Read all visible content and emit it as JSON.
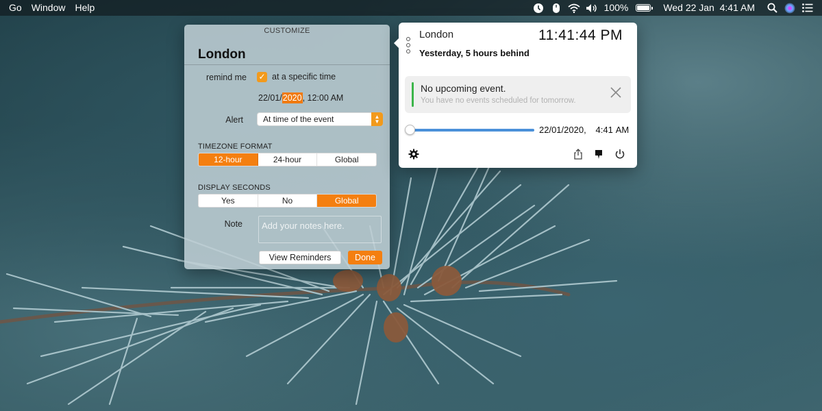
{
  "menubar": {
    "menus": [
      "Go",
      "Window",
      "Help"
    ],
    "battery": "100%",
    "datetime": "Wed 22 Jan  4:41 AM",
    "status_icons": [
      "clock-icon",
      "mouse-icon",
      "wifi-icon",
      "volume-icon",
      "battery-icon",
      "search-icon",
      "siri-icon",
      "list-icon"
    ]
  },
  "customize": {
    "title": "CUSTOMIZE",
    "city": "London",
    "remind_label": "remind me",
    "remind_checked": true,
    "remind_option": "at a specific time",
    "date_day_month": "22/01/",
    "date_year": "2020",
    "date_time": ", 12:00 AM",
    "alert_label": "Alert",
    "alert_value": "At time of the event",
    "timezone_section": "TIMEZONE FORMAT",
    "timezone_options": [
      "12-hour",
      "24-hour",
      "Global"
    ],
    "timezone_selected": "12-hour",
    "seconds_section": "DISPLAY SECONDS",
    "seconds_options": [
      "Yes",
      "No",
      "Global"
    ],
    "seconds_selected": "Global",
    "note_label": "Note",
    "note_placeholder": "Add your notes here.",
    "view_reminders_label": "View Reminders",
    "done_label": "Done",
    "accent": "#f47f10"
  },
  "clock": {
    "city": "London",
    "time": "11:41:44 PM",
    "offset": "Yesterday, 5 hours behind",
    "event_title": "No upcoming event.",
    "event_subtitle": "You have no events scheduled for tomorrow.",
    "event_accent": "#3cb54a",
    "slider_label": "22/01/2020,   4:41 AM",
    "footer_icons": [
      "gear-icon",
      "share-icon",
      "pin-icon",
      "power-icon"
    ],
    "slider_color": "#4a90d9"
  }
}
